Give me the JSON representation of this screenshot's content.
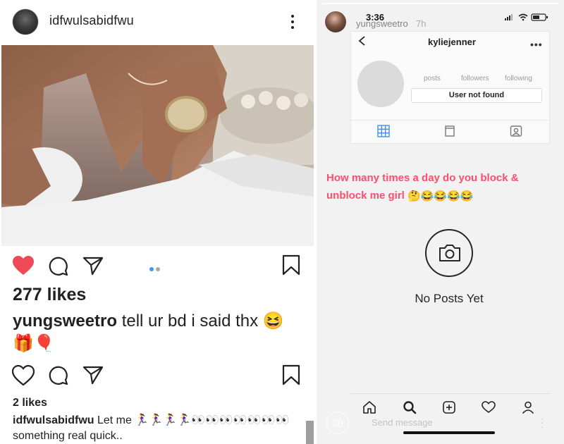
{
  "post": {
    "username": "idfwulsabidfwu",
    "likes": "277 likes",
    "comment_user": "yungsweetro",
    "comment_text": " tell ur bd i said thx ",
    "comment_emoji_1": "😆",
    "comment_emoji_2": "🎁🎈",
    "likes_small": "2 likes",
    "caption_user": "idfwulsabidfwu",
    "caption_text": " Let me ",
    "caption_emojis": "🏃‍♀️🏃‍♀️🏃‍♀️🏃‍♀️👀👀👀👀👀👀👀",
    "caption_text_2": "something real quick..",
    "carousel": {
      "count": 2,
      "active": 1
    },
    "colors": {
      "heart": "#ed4956",
      "dot_active": "#3897f0",
      "dot_inactive": "#a8a8a8"
    }
  },
  "story": {
    "time": "3:36",
    "username": "yungsweetro",
    "age": "7h",
    "profile": {
      "name": "kyliejenner",
      "stats": [
        "posts",
        "followers",
        "following"
      ],
      "button": "User not found"
    },
    "text": "How many times a day do you block & unblock me girl ",
    "text_emojis": "🤔😂😂😂😂",
    "empty_label": "No Posts Yet",
    "send_placeholder": "Send message",
    "colors": {
      "text": "#ff4d6d",
      "tab_active": "#3897f0"
    },
    "icons": [
      "back-chevron-icon",
      "more-icon",
      "grid-icon",
      "igtv-icon",
      "tagged-icon",
      "camera-icon",
      "home-icon",
      "search-icon",
      "add-icon",
      "heart-icon",
      "profile-icon"
    ]
  }
}
